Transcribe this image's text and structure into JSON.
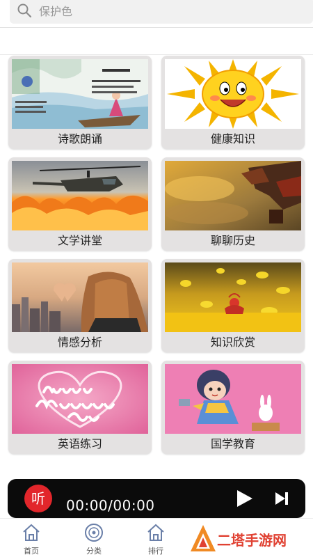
{
  "search": {
    "placeholder": "保护色"
  },
  "categories": [
    {
      "label": "诗歌朗诵",
      "image": "poem-painting"
    },
    {
      "label": "健康知识",
      "image": "smiling-sun"
    },
    {
      "label": "文学讲堂",
      "image": "helicopter-fire"
    },
    {
      "label": "聊聊历史",
      "image": "temple-roof"
    },
    {
      "label": "情感分析",
      "image": "heart-hands-city"
    },
    {
      "label": "知识欣赏",
      "image": "yellow-leaves"
    },
    {
      "label": "英语练习",
      "image": "happy-mothers-day"
    },
    {
      "label": "国学教育",
      "image": "cartoon-girl"
    }
  ],
  "player": {
    "logo": "听",
    "time": "00:00/00:00"
  },
  "tabs": [
    {
      "label": "首页",
      "icon": "home-icon"
    },
    {
      "label": "分类",
      "icon": "disc-icon"
    },
    {
      "label": "排行",
      "icon": "ranking-icon"
    }
  ],
  "watermark": {
    "text": "二塔手游网"
  },
  "colors": {
    "accent": "#e2262b",
    "player_bg": "#0b0b0b",
    "card_bg": "#e4e2e2"
  }
}
